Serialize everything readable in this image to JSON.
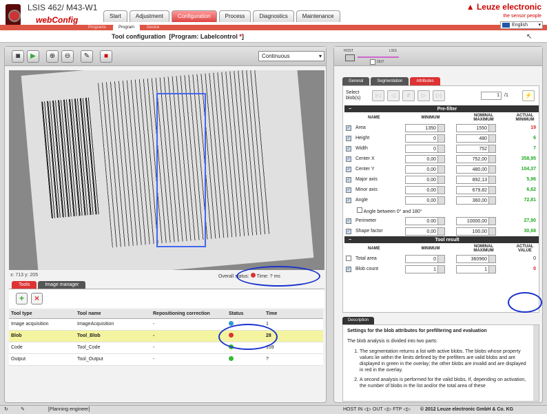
{
  "header": {
    "product": "LSIS 462/ M43-W1",
    "app": "webConfig",
    "brand": "Leuze electronic",
    "tagline": "the sensor people",
    "language": "English"
  },
  "main_tabs": [
    "Start",
    "Adjustment",
    "Configuration",
    "Process",
    "Diagnostics",
    "Maintenance"
  ],
  "sub_tabs": [
    "Programs",
    "Program",
    "Device"
  ],
  "title": {
    "prefix": "Tool configuration",
    "program": "[Program: Labelcontrol ",
    "mark": "*",
    "close": "]"
  },
  "left": {
    "mode": "Continuous",
    "coords": "x: 713 y: 205",
    "overall_status": "Overall status:",
    "time_label": "Time:",
    "time_value": "? ms",
    "tabs": [
      "Tools",
      "Image manager"
    ],
    "columns": [
      "Tool type",
      "Tool name",
      "Repositioning correction",
      "Status",
      "Time"
    ],
    "rows": [
      {
        "type": "Image acquisition",
        "name": "ImageAcquisition",
        "rep": "-",
        "status": "blue",
        "time": "1"
      },
      {
        "type": "Blob",
        "name": "Tool_Blob",
        "rep": "-",
        "status": "red",
        "time": "28"
      },
      {
        "type": "Code",
        "name": "Tool_Code",
        "rep": "-",
        "status": "green",
        "time": "159"
      },
      {
        "type": "Output",
        "name": "Tool_Output",
        "rep": "-",
        "status": "green",
        "time": "?"
      }
    ]
  },
  "right": {
    "io_labels": {
      "host": "HOST",
      "lsis": "LSIS",
      "out": "OUT"
    },
    "tabs": [
      "General",
      "Segmentation",
      "Attributes"
    ],
    "select_label_1": "Select",
    "select_label_2": "blob(s)",
    "page": "1",
    "page_total": "/1",
    "prefilter_title": "Pre-filter",
    "headers": {
      "name": "NAME",
      "nominal": "NOMINAL",
      "min": "MINIMUM",
      "max": "MAXIMUM",
      "actual": "ACTUAL",
      "actual_min": "MINIMUM",
      "actual_value": "VALUE"
    },
    "prefilter": [
      {
        "name": "Area",
        "min": "1350",
        "max": "1550",
        "actual": "19",
        "c": "r"
      },
      {
        "name": "Height",
        "min": "0",
        "max": "480",
        "actual": "6",
        "c": "g"
      },
      {
        "name": "Width",
        "min": "0",
        "max": "752",
        "actual": "7",
        "c": "g"
      },
      {
        "name": "Center X",
        "min": "0,00",
        "max": "752,00",
        "actual": "358,95",
        "c": "g"
      },
      {
        "name": "Center Y",
        "min": "0,00",
        "max": "480,00",
        "actual": "104,37",
        "c": "g"
      },
      {
        "name": "Major axis",
        "min": "0,00",
        "max": "892,13",
        "actual": "5,96",
        "c": "g"
      },
      {
        "name": "Minor axis",
        "min": "0,00",
        "max": "679,82",
        "actual": "6,62",
        "c": "g"
      },
      {
        "name": "Angle",
        "min": "0,00",
        "max": "360,00",
        "actual": "72,81",
        "c": "g"
      }
    ],
    "angle_between": "Angle between 0° and 180°",
    "prefilter2": [
      {
        "name": "Perimeter",
        "min": "0.00",
        "max": "10000,00",
        "actual": "27,90",
        "c": "g"
      },
      {
        "name": "Shape factor",
        "min": "0,00",
        "max": "100,00",
        "actual": "30,68",
        "c": "g"
      }
    ],
    "tool_result_title": "Tool result",
    "result": [
      {
        "name": "Total area",
        "min": "0",
        "max": "360960",
        "actual": "0",
        "c": "n",
        "checked": false
      },
      {
        "name": "Blob count",
        "min": "1",
        "max": "1",
        "actual": "0",
        "c": "r",
        "checked": true
      }
    ],
    "desc_tab": "Description",
    "desc_title": "Settings for the blob attributes for prefiltering and evaluation",
    "desc_intro": "The blob analysis is divided into two parts:",
    "desc_items": [
      "The segmentation returns a list with active blobs. The blobs whose property values lie within the limits defined by the prefilters are valid blobs and are displayed in green in the overlay; the other blobs are invalid and are displayed in red in the overlay.",
      "A second analysis is performed for the valid blobs. If, depending on activation, the number of blobs in the list and/or the total area of these"
    ]
  },
  "footer": {
    "role": "[Planning engineer]",
    "status": "HOST IN ◁▷ OUT ◁▷ FTP ◁▷",
    "copyright": "© 2012 Leuze electronic GmbH & Co. KG"
  }
}
